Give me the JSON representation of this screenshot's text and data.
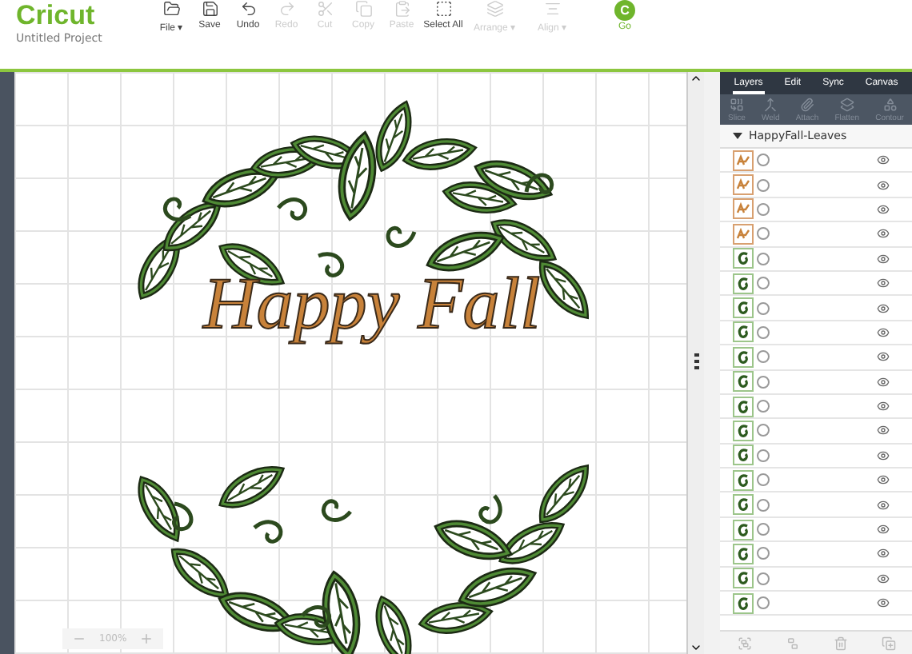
{
  "header": {
    "logo": "Cricut",
    "project": "Untitled Project"
  },
  "toolbar": [
    {
      "label": "File ▾",
      "kind": "file",
      "disabled": false
    },
    {
      "label": "Save",
      "kind": "save",
      "disabled": false
    },
    {
      "label": "Undo",
      "kind": "undo",
      "disabled": false
    },
    {
      "label": "Redo",
      "kind": "redo",
      "disabled": true
    },
    {
      "label": "Cut",
      "kind": "cut",
      "disabled": true
    },
    {
      "label": "Copy",
      "kind": "copy",
      "disabled": true
    },
    {
      "label": "Paste",
      "kind": "paste",
      "disabled": true
    },
    {
      "label": "Select All",
      "kind": "select",
      "disabled": false
    },
    {
      "label": "Arrange ▾",
      "kind": "arrange",
      "disabled": true
    },
    {
      "label": "Align ▾",
      "kind": "align",
      "disabled": true
    }
  ],
  "go_button": {
    "badge": "C",
    "label": "Go"
  },
  "canvas": {
    "artwork_text": "Happy Fall",
    "zoom": "100%"
  },
  "panel": {
    "tabs": [
      {
        "label": "Layers",
        "selected": true
      },
      {
        "label": "Edit",
        "selected": false
      },
      {
        "label": "Sync",
        "selected": false
      },
      {
        "label": "Canvas",
        "selected": false
      }
    ],
    "tools": [
      "Slice",
      "Weld",
      "Attach",
      "Flatten",
      "Contour"
    ],
    "group": "HappyFall-Leaves",
    "layers": [
      {
        "kind": "text",
        "visible": true
      },
      {
        "kind": "text",
        "visible": true
      },
      {
        "kind": "text",
        "visible": true
      },
      {
        "kind": "text",
        "visible": true
      },
      {
        "kind": "shape",
        "visible": true
      },
      {
        "kind": "shape",
        "visible": true
      },
      {
        "kind": "shape",
        "visible": true
      },
      {
        "kind": "shape",
        "visible": true
      },
      {
        "kind": "shape",
        "visible": true
      },
      {
        "kind": "shape",
        "visible": true
      },
      {
        "kind": "shape",
        "visible": true
      },
      {
        "kind": "shape",
        "visible": true
      },
      {
        "kind": "shape",
        "visible": true
      },
      {
        "kind": "shape",
        "visible": true
      },
      {
        "kind": "shape",
        "visible": true
      },
      {
        "kind": "shape",
        "visible": true
      },
      {
        "kind": "shape",
        "visible": true
      },
      {
        "kind": "shape",
        "visible": true
      },
      {
        "kind": "shape",
        "visible": true
      }
    ]
  }
}
